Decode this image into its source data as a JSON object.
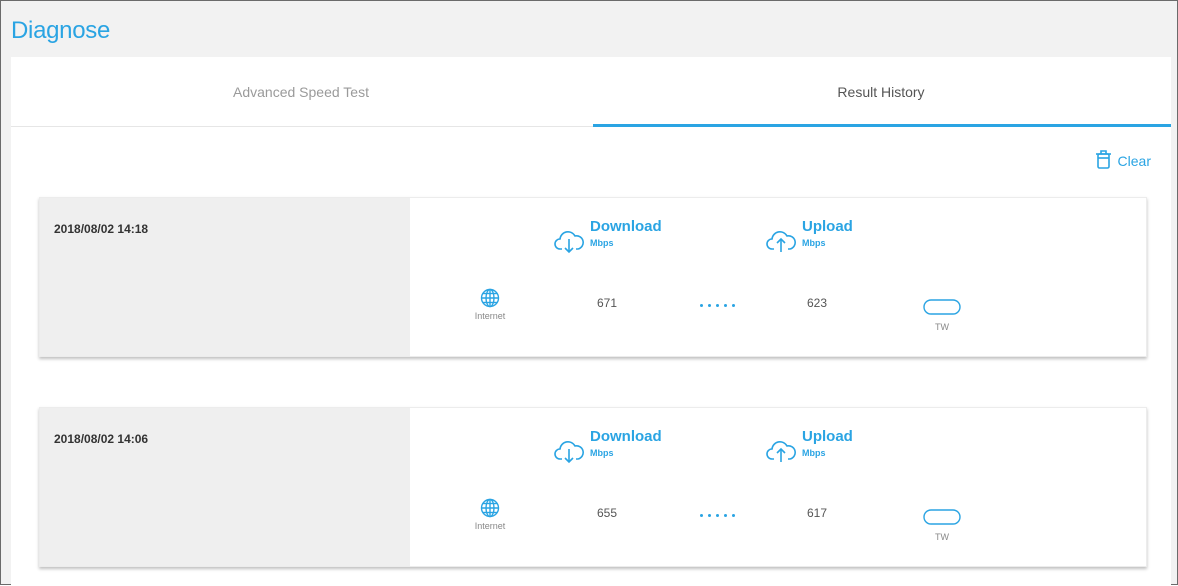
{
  "page": {
    "title": "Diagnose"
  },
  "tabs": [
    {
      "label": "Advanced Speed Test",
      "active": false
    },
    {
      "label": "Result History",
      "active": true
    }
  ],
  "actions": {
    "clear_label": "Clear",
    "clear_icon": "trash-icon"
  },
  "colors": {
    "accent": "#2aa4e3",
    "card_left_bg": "#efefef",
    "background": "#f2f2f2"
  },
  "results": [
    {
      "timestamp": "2018/08/02 14:18",
      "download": {
        "label": "Download",
        "unit": "Mbps",
        "value": "671",
        "icon": "cloud-download-icon"
      },
      "upload": {
        "label": "Upload",
        "unit": "Mbps",
        "value": "623",
        "icon": "cloud-upload-icon"
      },
      "source": {
        "label": "Internet",
        "icon": "globe-icon"
      },
      "server": {
        "label": "TW",
        "icon": "server-icon"
      }
    },
    {
      "timestamp": "2018/08/02 14:06",
      "download": {
        "label": "Download",
        "unit": "Mbps",
        "value": "655",
        "icon": "cloud-download-icon"
      },
      "upload": {
        "label": "Upload",
        "unit": "Mbps",
        "value": "617",
        "icon": "cloud-upload-icon"
      },
      "source": {
        "label": "Internet",
        "icon": "globe-icon"
      },
      "server": {
        "label": "TW",
        "icon": "server-icon"
      }
    }
  ]
}
